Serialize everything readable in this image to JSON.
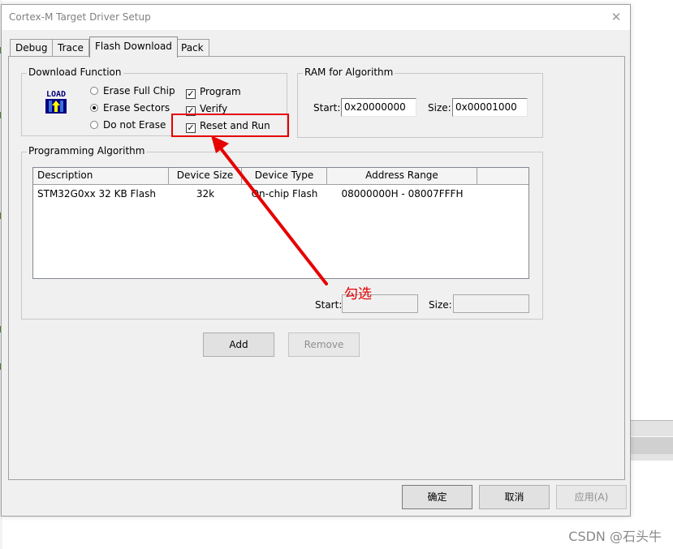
{
  "window": {
    "title": "Cortex-M Target Driver Setup",
    "close_glyph": "✕"
  },
  "tabs": [
    {
      "label": "Debug"
    },
    {
      "label": "Trace"
    },
    {
      "label": "Flash Download"
    },
    {
      "label": "Pack"
    }
  ],
  "download_function": {
    "title": "Download Function",
    "icon": "load-icon",
    "icon_text": "LOAD",
    "erase_options": [
      {
        "label": "Erase Full Chip",
        "selected": false
      },
      {
        "label": "Erase Sectors",
        "selected": true
      },
      {
        "label": "Do not Erase",
        "selected": false
      }
    ],
    "checks": [
      {
        "label": "Program",
        "checked": true
      },
      {
        "label": "Verify",
        "checked": true
      },
      {
        "label": "Reset and Run",
        "checked": true
      }
    ],
    "check_glyph": "✓"
  },
  "ram_for_algorithm": {
    "title": "RAM for Algorithm",
    "start_label": "Start:",
    "start_value": "0x20000000",
    "size_label": "Size:",
    "size_value": "0x00001000"
  },
  "programming_algorithm": {
    "title": "Programming Algorithm",
    "columns": [
      "Description",
      "Device Size",
      "Device Type",
      "Address Range"
    ],
    "rows": [
      {
        "description": "STM32G0xx 32 KB Flash",
        "device_size": "32k",
        "device_type": "On-chip Flash",
        "address_range": "08000000H - 08007FFFH"
      }
    ],
    "start_label": "Start:",
    "start_value": "",
    "size_label": "Size:",
    "size_value": ""
  },
  "buttons": {
    "add": "Add",
    "remove": "Remove"
  },
  "footer_buttons": {
    "ok": "确定",
    "cancel": "取消",
    "apply": "应用(A)"
  },
  "annotation": {
    "text": "勾选",
    "color": "#e60000"
  },
  "watermark": "CSDN @石头牛"
}
